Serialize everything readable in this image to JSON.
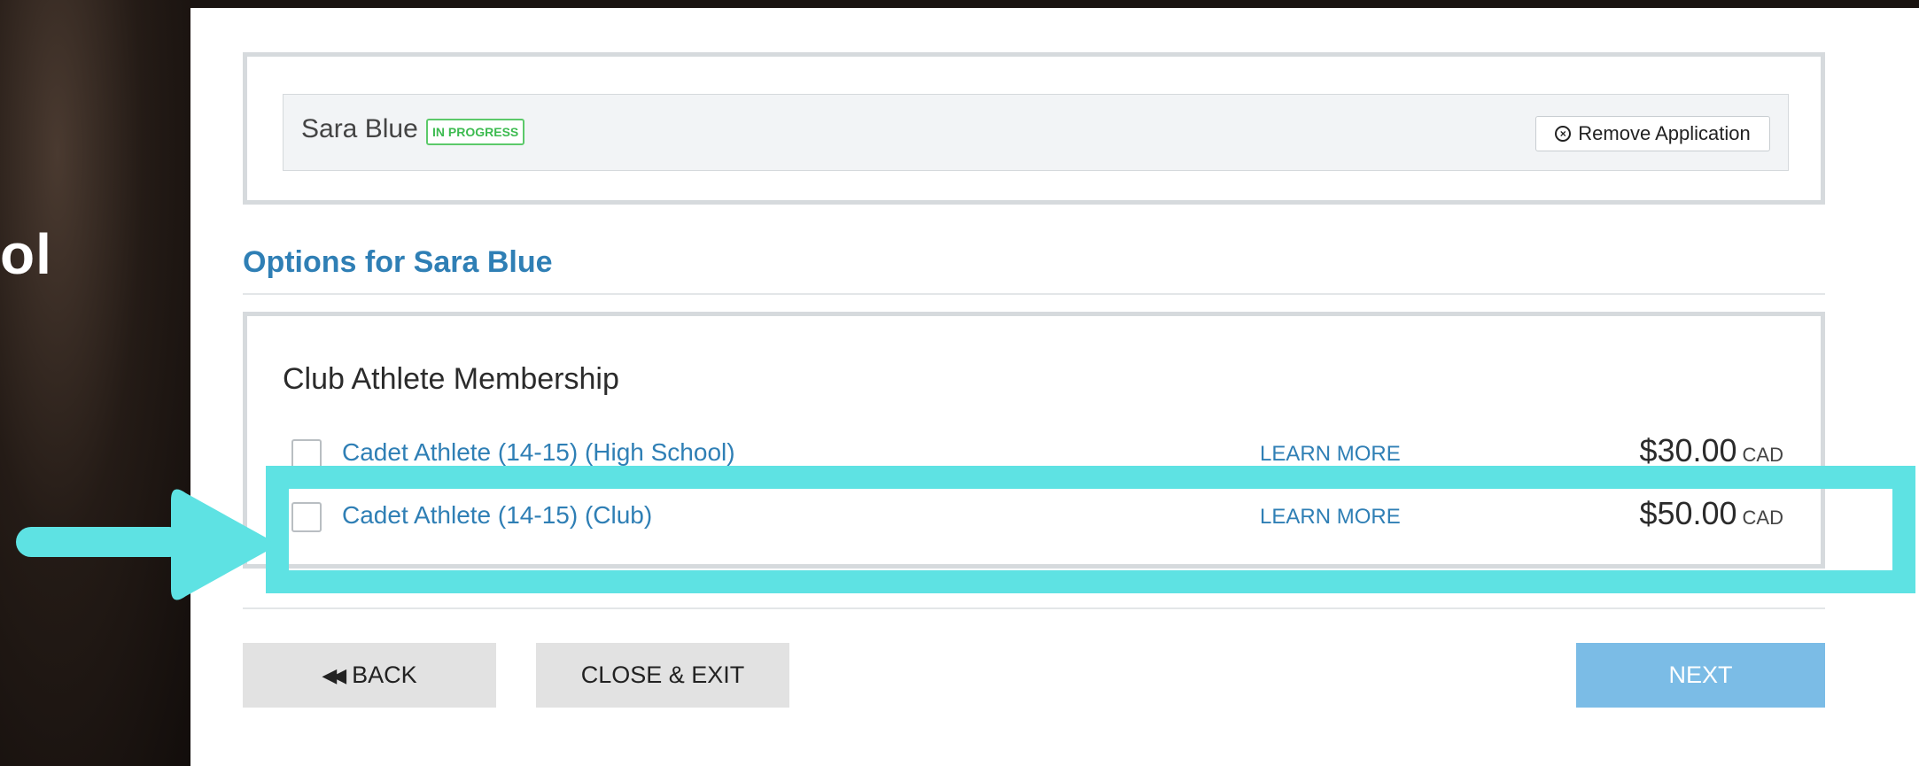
{
  "background": {
    "partial_text": "ol"
  },
  "application": {
    "applicant_name": "Sara Blue",
    "status": "IN PROGRESS",
    "remove_label": "Remove Application"
  },
  "options": {
    "title": "Options for Sara Blue",
    "membership_title": "Club Athlete Membership",
    "items": [
      {
        "label": "Cadet Athlete (14-15) (High School)",
        "learn_more": "LEARN MORE",
        "price": "$30.00",
        "currency": "CAD",
        "checked": false
      },
      {
        "label": "Cadet Athlete (14-15) (Club)",
        "learn_more": "LEARN MORE",
        "price": "$50.00",
        "currency": "CAD",
        "checked": false
      }
    ]
  },
  "buttons": {
    "back": "BACK",
    "close_exit": "CLOSE & EXIT",
    "next": "NEXT"
  },
  "colors": {
    "accent_blue": "#2f7fb5",
    "status_green": "#3dbb50",
    "next_button": "#7bbce6",
    "annotation_cyan": "#5ee2e3"
  }
}
